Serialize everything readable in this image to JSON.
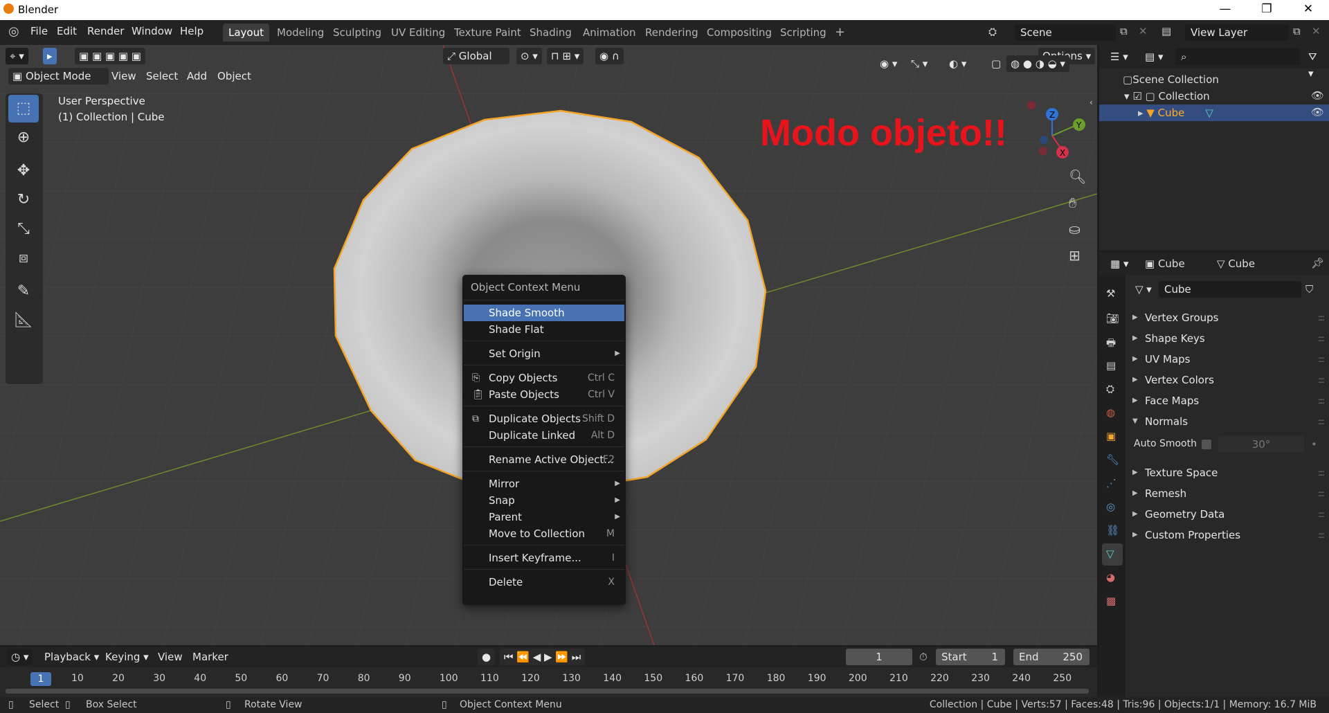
{
  "window": {
    "title": "Blender",
    "minimize": "—",
    "maximize": "❐",
    "close": "✕"
  },
  "topbar": {
    "menus": [
      "File",
      "Edit",
      "Render",
      "Window",
      "Help"
    ],
    "workspaces": [
      "Layout",
      "Modeling",
      "Sculpting",
      "UV Editing",
      "Texture Paint",
      "Shading",
      "Animation",
      "Rendering",
      "Compositing",
      "Scripting"
    ],
    "add_workspace": "+",
    "scene": "Scene",
    "view_layer": "View Layer"
  },
  "viewport": {
    "mode": "Object Mode",
    "menus": [
      "View",
      "Select",
      "Add",
      "Object"
    ],
    "transform_orientation": "Global",
    "options": "Options",
    "overlay_line1": "User Perspective",
    "overlay_line2": "(1) Collection | Cube",
    "annotation": "Modo objeto!!",
    "annotation_color": "#e8141b",
    "gizmo": {
      "x": "X",
      "y": "Y",
      "z": "Z"
    }
  },
  "context_menu": {
    "title": "Object Context Menu",
    "items": [
      {
        "label": "Shade Smooth",
        "shortcut": ""
      },
      {
        "label": "Shade Flat",
        "shortcut": ""
      },
      {
        "label": "Set Origin",
        "shortcut": ""
      },
      {
        "label": "Copy Objects",
        "shortcut": "Ctrl C"
      },
      {
        "label": "Paste Objects",
        "shortcut": "Ctrl V"
      },
      {
        "label": "Duplicate Objects",
        "shortcut": "Shift D"
      },
      {
        "label": "Duplicate Linked",
        "shortcut": "Alt D"
      },
      {
        "label": "Rename Active Object...",
        "shortcut": "F2"
      },
      {
        "label": "Mirror",
        "shortcut": ""
      },
      {
        "label": "Snap",
        "shortcut": ""
      },
      {
        "label": "Parent",
        "shortcut": ""
      },
      {
        "label": "Move to Collection",
        "shortcut": "M"
      },
      {
        "label": "Insert Keyframe...",
        "shortcut": "I"
      },
      {
        "label": "Delete",
        "shortcut": "X"
      }
    ]
  },
  "outliner": {
    "scene_collection": "Scene Collection",
    "collection": "Collection",
    "object": "Cube"
  },
  "properties": {
    "tab_object": "Cube",
    "tab_data": "Cube",
    "mesh_name": "Cube",
    "panels": [
      "Vertex Groups",
      "Shape Keys",
      "UV Maps",
      "Vertex Colors",
      "Face Maps",
      "Normals"
    ],
    "auto_smooth_label": "Auto Smooth",
    "auto_smooth_angle": "30°",
    "panels_after": [
      "Texture Space",
      "Remesh",
      "Geometry Data",
      "Custom Properties"
    ]
  },
  "timeline": {
    "menus": [
      "Playback",
      "Keying",
      "View",
      "Marker"
    ],
    "current_frame": "1",
    "start_label": "Start",
    "start_value": "1",
    "end_label": "End",
    "end_value": "250",
    "frame_marker": "1",
    "ticks": [
      "10",
      "20",
      "30",
      "40",
      "50",
      "60",
      "70",
      "80",
      "90",
      "100",
      "110",
      "120",
      "130",
      "140",
      "150",
      "160",
      "170",
      "180",
      "190",
      "200",
      "210",
      "220",
      "230",
      "240",
      "250"
    ]
  },
  "statusbar": {
    "select": "Select",
    "box_select": "Box Select",
    "rotate_view": "Rotate View",
    "context_menu": "Object Context Menu",
    "stats": "Collection | Cube | Verts:57 | Faces:48 | Tris:96 | Objects:1/1 | Memory: 16.7 MiB"
  },
  "colors": {
    "accent": "#4772b3",
    "selection_outline": "#f5a42a",
    "active_object": "#e89a3a"
  }
}
